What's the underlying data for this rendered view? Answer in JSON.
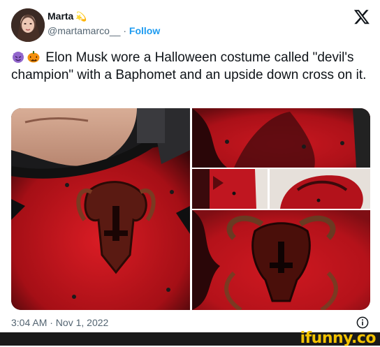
{
  "author": {
    "display_name": "Marta",
    "badge_emoji": "💫",
    "handle": "@martamarco__",
    "separator": "·",
    "follow_label": "Follow"
  },
  "tweet": {
    "emojis": [
      "smiling-imp",
      "jack-o-lantern"
    ],
    "text": "Elon Musk wore a Halloween costume called \"devil's champion\" with a Baphomet and an upside down cross on it."
  },
  "timestamp": "3:04 AM · Nov 1, 2022",
  "icons": {
    "brand": "x-logo-icon",
    "info": "info-icon"
  },
  "footer": {
    "watermark": "ifunny.co"
  },
  "colors": {
    "follow_link": "#1d9bf0",
    "secondary_text": "#536471",
    "primary_text": "#0f1419",
    "armor_red": "#c0141e",
    "watermark": "#f2c200"
  }
}
